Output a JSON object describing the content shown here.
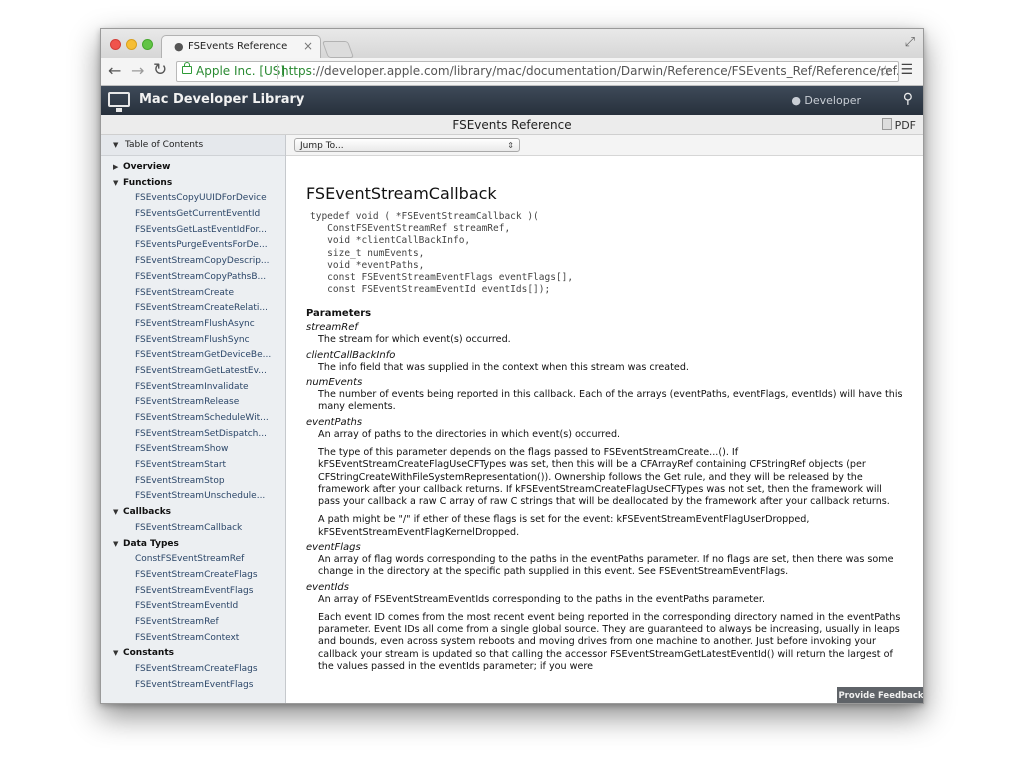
{
  "browser": {
    "tab_title": "FSEvents Reference",
    "tab_close": "×",
    "ev_label": "Apple Inc. [US]",
    "url_scheme": "https",
    "url_rest": "://developer.apple.com/library/mac/documentation/Darwin/Reference/FSEvents_Ref/Reference/ref...",
    "icons": {
      "back": "back-arrow-icon",
      "forward": "forward-arrow-icon",
      "reload": "reload-icon",
      "lock": "lock-icon",
      "star": "bookmark-star-icon",
      "menu": "menu-icon",
      "fullscreen": "fullscreen-icon"
    }
  },
  "library": {
    "title": "Mac Developer Library",
    "developer_label": "Developer"
  },
  "docbar": {
    "title": "FSEvents Reference",
    "pdf_label": "PDF"
  },
  "sidebar": {
    "toc_label": "Table of Contents",
    "sections": [
      {
        "label": "Overview",
        "expanded": false,
        "items": []
      },
      {
        "label": "Functions",
        "expanded": true,
        "items": [
          "FSEventsCopyUUIDForDevice",
          "FSEventsGetCurrentEventId",
          "FSEventsGetLastEventIdFor...",
          "FSEventsPurgeEventsForDe...",
          "FSEventStreamCopyDescrip...",
          "FSEventStreamCopyPathsB...",
          "FSEventStreamCreate",
          "FSEventStreamCreateRelati...",
          "FSEventStreamFlushAsync",
          "FSEventStreamFlushSync",
          "FSEventStreamGetDeviceBe...",
          "FSEventStreamGetLatestEv...",
          "FSEventStreamInvalidate",
          "FSEventStreamRelease",
          "FSEventStreamScheduleWit...",
          "FSEventStreamSetDispatch...",
          "FSEventStreamShow",
          "FSEventStreamStart",
          "FSEventStreamStop",
          "FSEventStreamUnschedule..."
        ]
      },
      {
        "label": "Callbacks",
        "expanded": true,
        "items": [
          "FSEventStreamCallback"
        ]
      },
      {
        "label": "Data Types",
        "expanded": true,
        "items": [
          "ConstFSEventStreamRef",
          "FSEventStreamCreateFlags",
          "FSEventStreamEventFlags",
          "FSEventStreamEventId",
          "FSEventStreamRef",
          "FSEventStreamContext"
        ]
      },
      {
        "label": "Constants",
        "expanded": true,
        "items": [
          "FSEventStreamCreateFlags",
          "FSEventStreamEventFlags"
        ]
      }
    ]
  },
  "content": {
    "jump_to": "Jump To...",
    "heading": "FSEventStreamCallback",
    "code": "typedef void ( *FSEventStreamCallback )(\n   ConstFSEventStreamRef streamRef,\n   void *clientCallBackInfo,\n   size_t numEvents,\n   void *eventPaths,\n   const FSEventStreamEventFlags eventFlags[],\n   const FSEventStreamEventId eventIds[]);",
    "parameters_label": "Parameters",
    "parameters": [
      {
        "name": "streamRef",
        "desc": [
          "The stream for which event(s) occurred."
        ]
      },
      {
        "name": "clientCallBackInfo",
        "desc": [
          "The info field that was supplied in the context when this stream was created."
        ]
      },
      {
        "name": "numEvents",
        "desc": [
          "The number of events being reported in this callback. Each of the arrays (eventPaths, eventFlags, eventIds) will have this many elements."
        ]
      },
      {
        "name": "eventPaths",
        "desc": [
          "An array of paths to the directories in which event(s) occurred.",
          "The type of this parameter depends on the flags passed to FSEventStreamCreate...(). If kFSEventStreamCreateFlagUseCFTypes was set, then this will be a CFArrayRef containing CFStringRef objects (per CFStringCreateWithFileSystemRepresentation()). Ownership follows the Get rule, and they will be released by the framework after your callback returns. If kFSEventStreamCreateFlagUseCFTypes was not set, then the framework will pass your callback a raw C array of raw C strings that will be deallocated by the framework after your callback returns.",
          "A path might be \"/\" if ether of these flags is set for the event: kFSEventStreamEventFlagUserDropped, kFSEventStreamEventFlagKernelDropped."
        ]
      },
      {
        "name": "eventFlags",
        "desc": [
          "An array of flag words corresponding to the paths in the eventPaths parameter. If no flags are set, then there was some change in the directory at the specific path supplied in this event. See FSEventStreamEventFlags."
        ]
      },
      {
        "name": "eventIds",
        "desc": [
          "An array of FSEventStreamEventIds corresponding to the paths in the eventPaths parameter.",
          "Each event ID comes from the most recent event being reported in the corresponding directory named in the eventPaths parameter. Event IDs all come from a single global source. They are guaranteed to always be increasing, usually in leaps and bounds, even across system reboots and moving drives from one machine to another. Just before invoking your callback your stream is updated so that calling the accessor FSEventStreamGetLatestEventId() will return the largest of the values passed in the eventIds parameter; if you were"
        ]
      }
    ],
    "feedback_label": "Provide Feedback"
  },
  "colors": {
    "header_bg": "#2f3a48",
    "link": "#2b4668",
    "secure_green": "#2a8a32"
  }
}
